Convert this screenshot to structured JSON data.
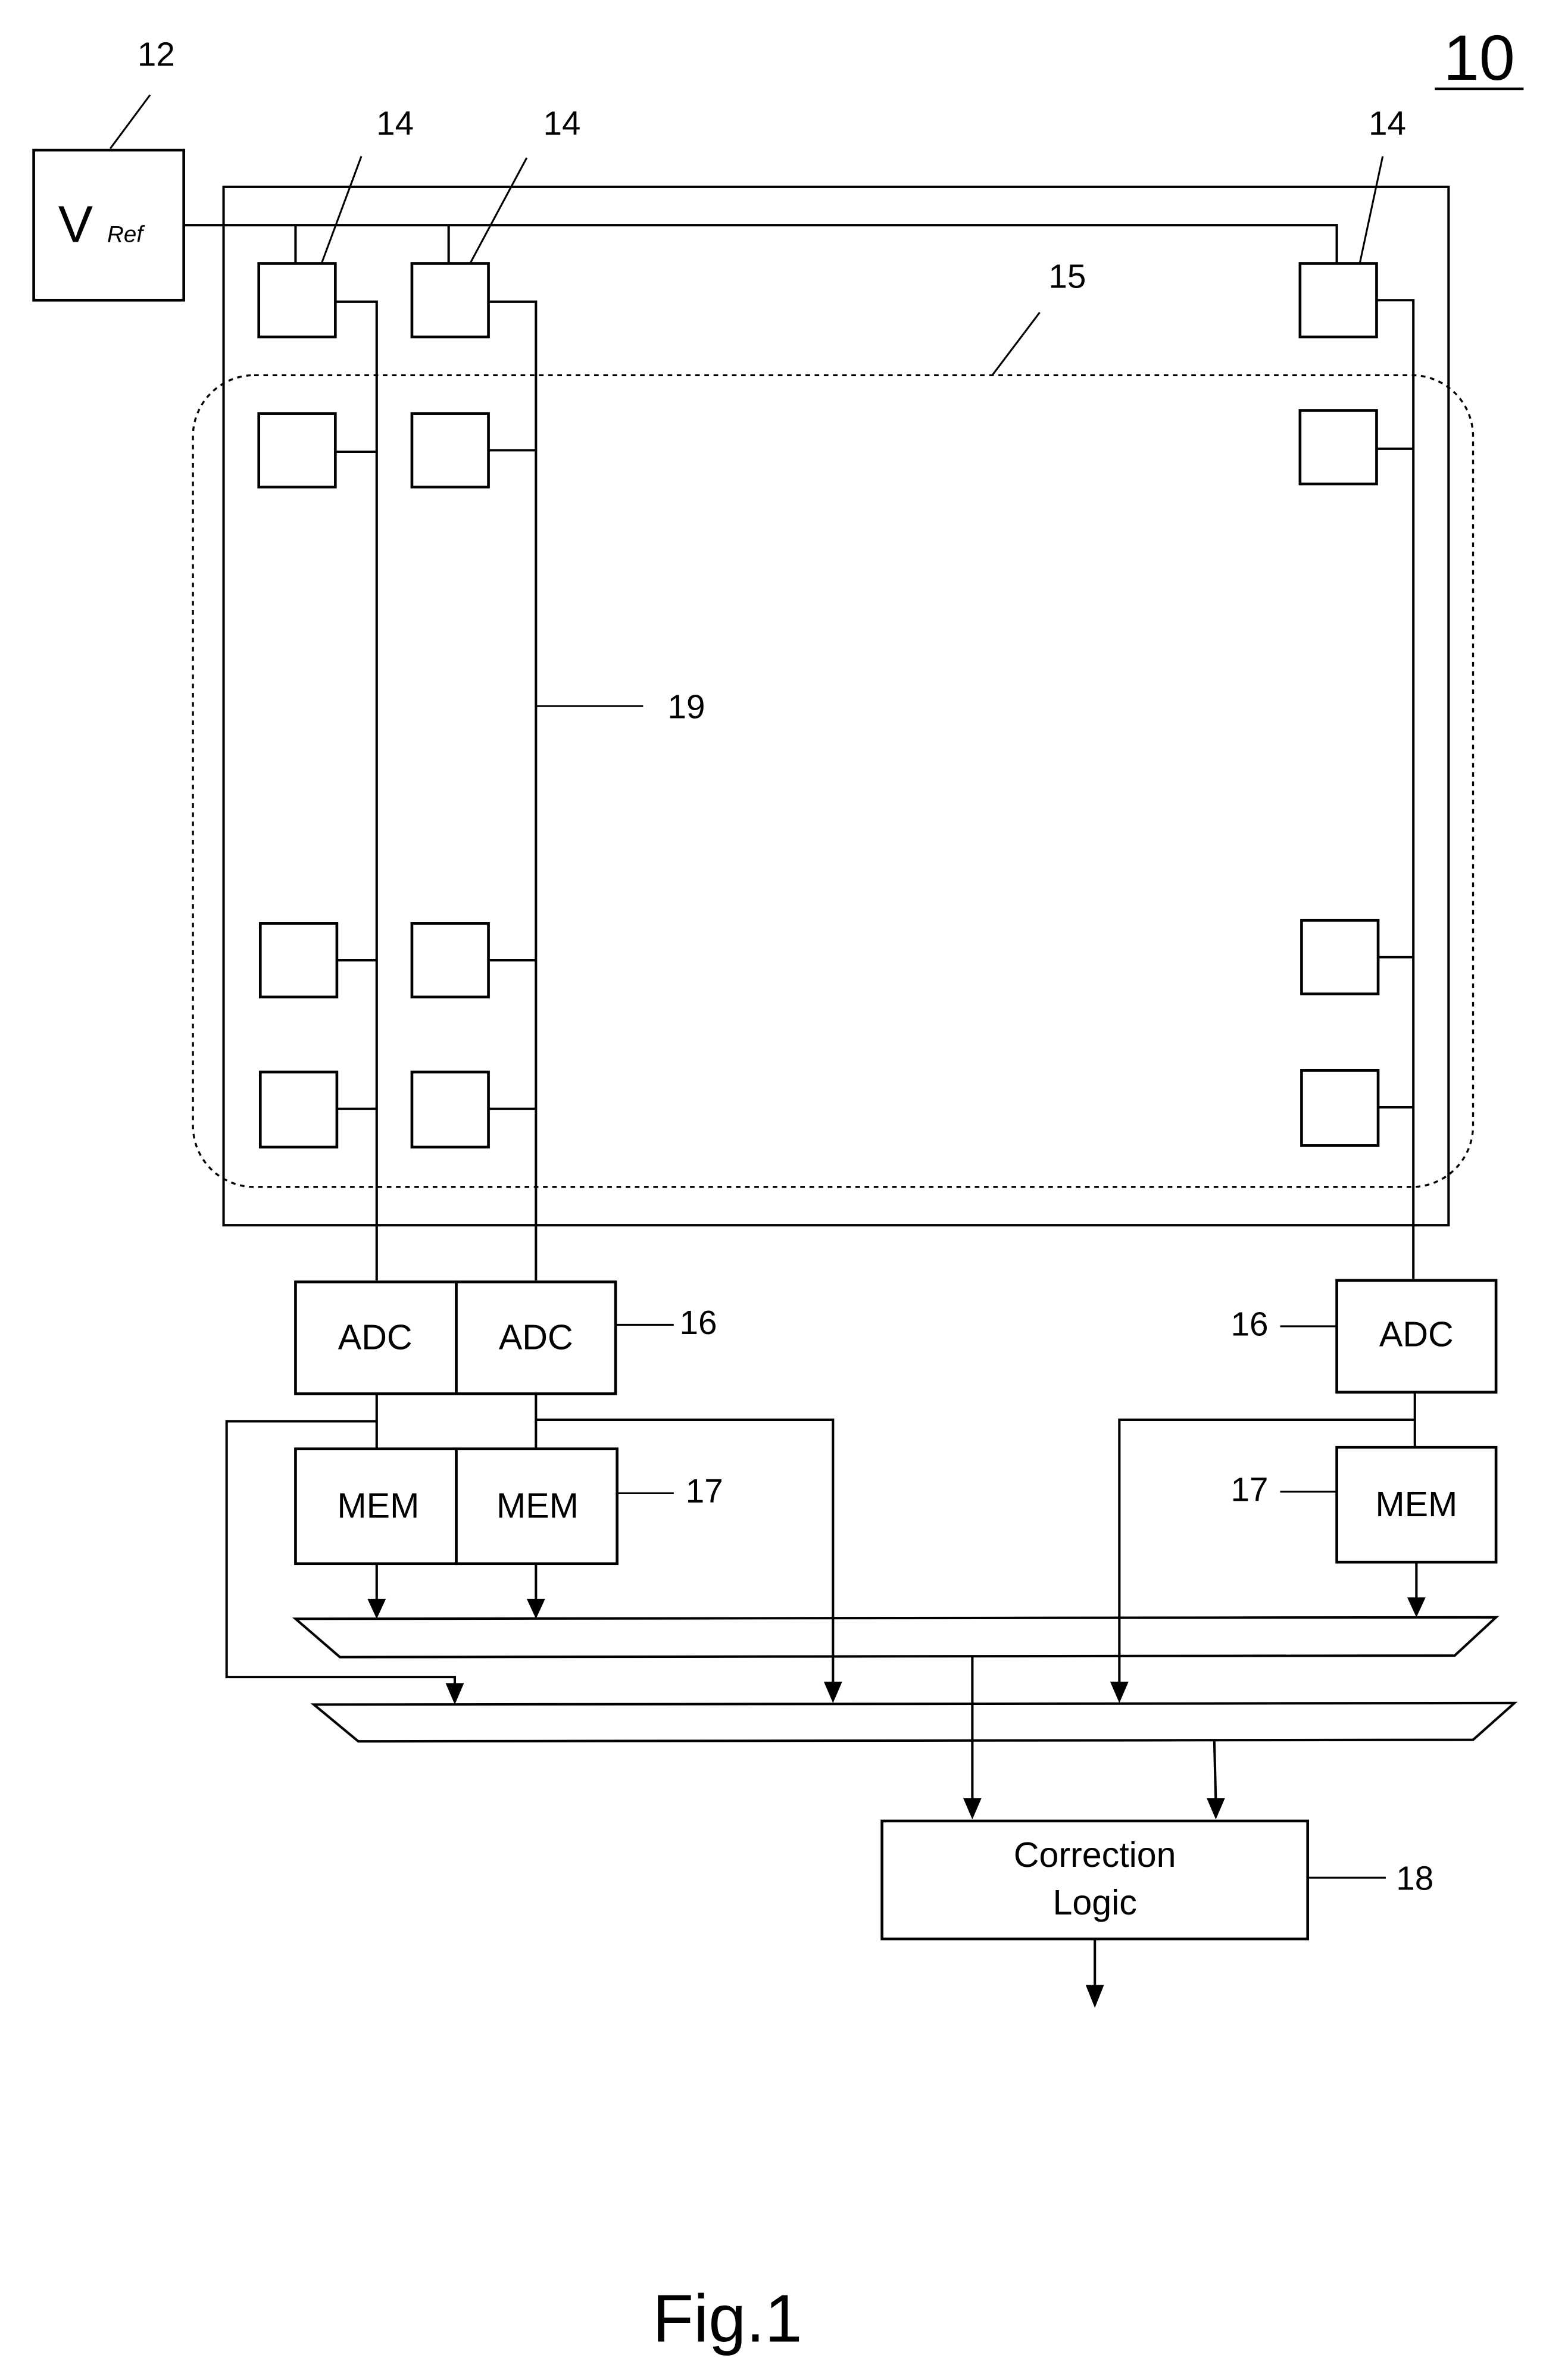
{
  "figure": {
    "number_label": "10",
    "caption": "Fig.1"
  },
  "vref": {
    "ref_numeral": "12",
    "main": "V",
    "subscript": "Ref"
  },
  "reference_numerals": {
    "reference_cell": "14",
    "pixel_array": "15",
    "column_line": "19",
    "adc": "16",
    "memory": "17",
    "correction": "18"
  },
  "blocks": {
    "adc_label": "ADC",
    "mem_label": "MEM",
    "correction_line1": "Correction",
    "correction_line2": "Logic"
  },
  "columns": [
    {
      "id": "col-1",
      "adc": "ADC",
      "mem": "MEM"
    },
    {
      "id": "col-2",
      "adc": "ADC",
      "mem": "MEM"
    },
    {
      "id": "col-n",
      "adc": "ADC",
      "mem": "MEM"
    }
  ]
}
